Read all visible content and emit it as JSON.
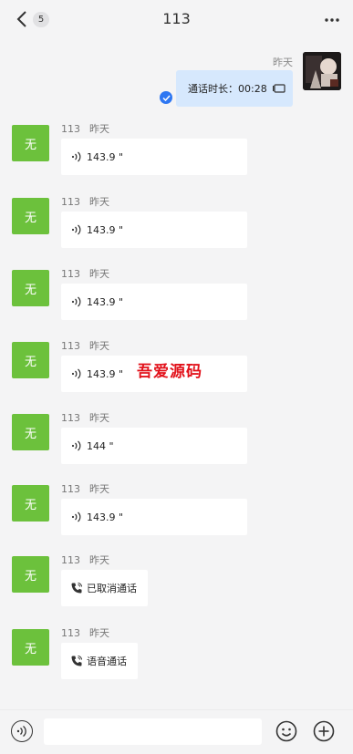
{
  "header": {
    "back_icon": "chevron-left-icon",
    "unread_count": "5",
    "title": "113",
    "more_icon": "more-dots-icon"
  },
  "outgoing": {
    "name": "昨天",
    "text": "通话时长：00:28",
    "call_icon": "video-call-icon",
    "status_icon": "sent-check-icon"
  },
  "messages": [
    {
      "avatar": "无",
      "name": "113",
      "time": "昨天",
      "type": "voice",
      "text": "143.9 \""
    },
    {
      "avatar": "无",
      "name": "113",
      "time": "昨天",
      "type": "voice",
      "text": "143.9 \""
    },
    {
      "avatar": "无",
      "name": "113",
      "time": "昨天",
      "type": "voice",
      "text": "143.9 \""
    },
    {
      "avatar": "无",
      "name": "113",
      "time": "昨天",
      "type": "voice",
      "text": "143.9 \""
    },
    {
      "avatar": "无",
      "name": "113",
      "time": "昨天",
      "type": "voice",
      "text": "144 \""
    },
    {
      "avatar": "无",
      "name": "113",
      "time": "昨天",
      "type": "voice",
      "text": "143.9 \""
    },
    {
      "avatar": "无",
      "name": "113",
      "time": "昨天",
      "type": "call",
      "text": "已取消通话"
    },
    {
      "avatar": "无",
      "name": "113",
      "time": "昨天",
      "type": "call",
      "text": "语音通话"
    }
  ],
  "watermark": "吾爱源码",
  "input_bar": {
    "voice_icon": "voice-input-icon",
    "text_value": "",
    "emoji_icon": "emoji-icon",
    "plus_icon": "add-icon"
  },
  "colors": {
    "avatar_green": "#6cc13c",
    "outgoing_bubble": "#d6e8fd",
    "check_blue": "#2e77f2",
    "watermark_red": "#e2121b",
    "background": "#f4f4f5"
  }
}
